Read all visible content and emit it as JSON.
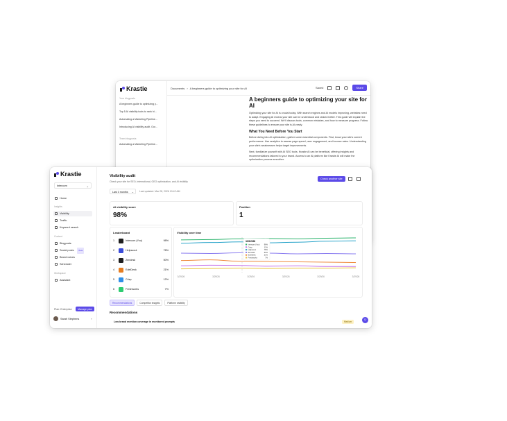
{
  "editor": {
    "brand": "Krastie",
    "sidebar": {
      "section_your_blogposts": "Your blogposts",
      "docs": [
        "A beginners guide to optimizing y...",
        "Top 5 AI visibility tools to rank hi...",
        "Automating a Marketing Pipeline...",
        "Introducing AI visibility audit. Our..."
      ],
      "section_team_blogposts": "Team blogposts",
      "team_docs": [
        "Automating a Marketing Pipeline..."
      ]
    },
    "breadcrumb": {
      "root": "Documents",
      "sep": "›",
      "current": "A beginners guide to optimizing your site for AI"
    },
    "toolbar": {
      "saved": "Saved",
      "share": "Share"
    },
    "article": {
      "title": "A beginners guide to optimizing your site for AI",
      "p1": "Optimizing your site for AI is crucial today. With search engines and AI models improving, websites need to adapt. Engaging AI means your site can be understood and ranked better. This guide will explain the steps you need to succeed. We'll discuss tools, common mistakes, and how to measure progress. Follow these guidelines to ensure your site is AI-ready.",
      "h2": "What You Need Before You Start",
      "p2": "Before diving into AI optimization, gather some essential components. First, know your site's current performance. Use analytics to assess page speed, user engagement, and bounce rates. Understanding your site's weaknesses helps target improvements.",
      "p3": "Next, familiarize yourself with AI SEO tools. Krastie AI can be beneficial, offering insights and recommendations tailored to your brand. Access to an AI platform like Krastie AI will make the optimization process smoother."
    }
  },
  "audit": {
    "brand": "Krastie",
    "workspace": "Intercom",
    "nav_sections": {
      "insights": "Insights",
      "content": "Content",
      "workspace": "Workspace"
    },
    "nav": {
      "home": "Home",
      "visibility": "Visibility",
      "traffic": "Traffic",
      "keyword_search": "Keyword search",
      "blogposts": "Blogposts",
      "social_posts": "Social posts",
      "beta": "Beta",
      "brand_voices": "Brand voices",
      "scheduler": "Scheduler",
      "assistant": "Assistant"
    },
    "plan_label": "Plan: Enterprise",
    "manage_plan": "Manage plan",
    "user_name": "Sarah Stephens",
    "page_title": "Visibility audit",
    "page_subtitle": "Check your site for SEO, international, GEO optimization, and AI visibility",
    "period": "Last 3 months",
    "last_updated": "Last updated: Mar 28, 2026 10:42 AM",
    "check_button": "Check another site",
    "ai_score_label": "AI visibility score",
    "ai_score_value": "98%",
    "position_label": "Position",
    "position_value": "1",
    "leaderboard_title": "Leaderboard",
    "leaderboard": [
      {
        "rank": "1",
        "name": "Intercom (You)",
        "pct": "98%",
        "color": "#1f1f1f"
      },
      {
        "rank": "2",
        "name": "Helpscout",
        "pct": "78%",
        "color": "#3b4cd9"
      },
      {
        "rank": "3",
        "name": "Zendesk",
        "pct": "50%",
        "color": "#1f1f1f"
      },
      {
        "rank": "4",
        "name": "EdelDesk",
        "pct": "21%",
        "color": "#e67e22"
      },
      {
        "rank": "5",
        "name": "Crisp",
        "pct": "12%",
        "color": "#2f8fe8"
      },
      {
        "rank": "6",
        "name": "Freshworks",
        "pct": "7%",
        "color": "#2ecc71"
      }
    ],
    "chart_title": "Visibility over time",
    "tooltip": {
      "date": "3/29/2026",
      "rows": [
        {
          "name": "Intercom (You)",
          "value": "98%"
        },
        {
          "name": "Crisp",
          "value": "12%"
        },
        {
          "name": "Helpscout",
          "value": "78%"
        },
        {
          "name": "Zendesk",
          "value": "50%"
        },
        {
          "name": "EdelDesk",
          "value": "21%"
        },
        {
          "name": "Freshworks",
          "value": "7%"
        }
      ]
    },
    "tabs": [
      "Recommendations",
      "Competitor insights",
      "Platform visibility"
    ],
    "recommendations_title": "Recommendations",
    "rec_item": "Low brand mention coverage in monitored prompts",
    "rec_badge": "Medium"
  },
  "chart_data": {
    "type": "line",
    "title": "Visibility over time",
    "x": [
      "3/29/26",
      "3/29/26",
      "3/29/26",
      "3/29/26",
      "3/29/26",
      "3/29/26"
    ],
    "ylim": [
      0,
      100
    ],
    "series": [
      {
        "name": "Intercom (You)",
        "color": "#2fb56f",
        "values": [
          92,
          93,
          95,
          96,
          95,
          97,
          98
        ]
      },
      {
        "name": "Helpscout",
        "color": "#27a3c9",
        "values": [
          82,
          84,
          86,
          83,
          85,
          88,
          89
        ]
      },
      {
        "name": "Zendesk",
        "color": "#8a7cf0",
        "values": [
          52,
          51,
          53,
          52,
          50,
          51,
          50
        ]
      },
      {
        "name": "EdelDesk",
        "color": "#f0893c",
        "values": [
          30,
          32,
          28,
          27,
          26,
          25,
          24
        ]
      },
      {
        "name": "Crisp",
        "color": "#c56fe8",
        "values": [
          14,
          16,
          15,
          13,
          14,
          12,
          12
        ]
      },
      {
        "name": "Freshworks",
        "color": "#e8c440",
        "values": [
          5,
          6,
          7,
          6,
          7,
          7,
          8
        ]
      }
    ],
    "grid": false
  }
}
